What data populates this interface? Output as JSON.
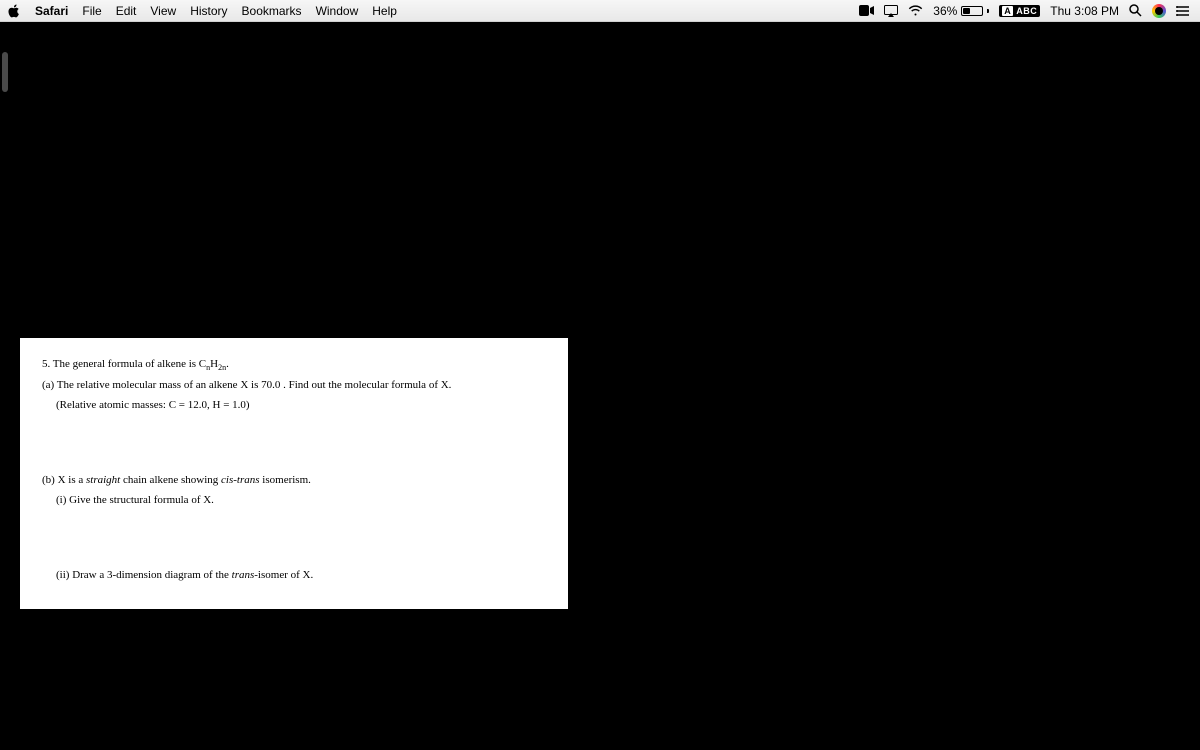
{
  "menubar": {
    "app": "Safari",
    "items": [
      "File",
      "Edit",
      "View",
      "History",
      "Bookmarks",
      "Window",
      "Help"
    ]
  },
  "status": {
    "battery_pct": "36%",
    "input_label": "ABC",
    "datetime": "Thu 3:08 PM"
  },
  "document": {
    "line1_pre": "5. The general formula of alkene is C",
    "line1_sub1": "n",
    "line1_mid": "H",
    "line1_sub2": "2n",
    "line1_post": ".",
    "line2": "(a) The relative molecular mass of an alkene X is 70.0 . Find out the molecular formula of X.",
    "line3": "(Relative atomic masses: C = 12.0, H = 1.0)",
    "line4_pre": "(b) X is a ",
    "line4_it1": "straight",
    "line4_mid": " chain alkene showing ",
    "line4_it2": "cis-trans",
    "line4_post": " isomerism.",
    "line5": "(i) Give the structural formula of X.",
    "line6_pre": "(ii) Draw a 3-dimension diagram of the ",
    "line6_it": "trans",
    "line6_post": "-isomer of X."
  }
}
